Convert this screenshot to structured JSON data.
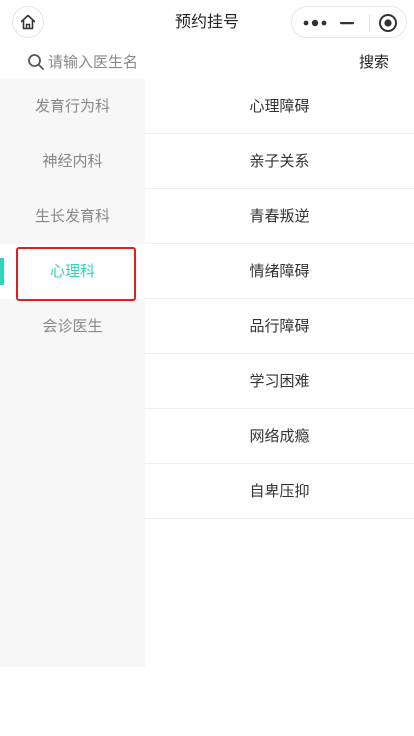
{
  "nav": {
    "title": "预约挂号",
    "home_icon": "home-icon",
    "capsule": {
      "more_icon": "more-dots-icon",
      "minimize_icon": "minimize-icon",
      "close_icon": "target-circle-icon"
    }
  },
  "search": {
    "placeholder": "请输入医生名",
    "value": "",
    "button_label": "搜索"
  },
  "sidebar": {
    "active_index": 3,
    "items": [
      {
        "label": "发育行为科"
      },
      {
        "label": "神经内科"
      },
      {
        "label": "生长发育科"
      },
      {
        "label": "心理科"
      },
      {
        "label": "会诊医生"
      }
    ]
  },
  "list": {
    "items": [
      {
        "label": "心理障碍"
      },
      {
        "label": "亲子关系"
      },
      {
        "label": "青春叛逆"
      },
      {
        "label": "情绪障碍"
      },
      {
        "label": "品行障碍"
      },
      {
        "label": "学习困难"
      },
      {
        "label": "网络成瘾"
      },
      {
        "label": "自卑压抑"
      }
    ]
  },
  "colors": {
    "accent": "#2fd3be",
    "highlight_border": "#e02020",
    "sidebar_bg": "#f7f7f7",
    "muted_text": "#888888"
  }
}
